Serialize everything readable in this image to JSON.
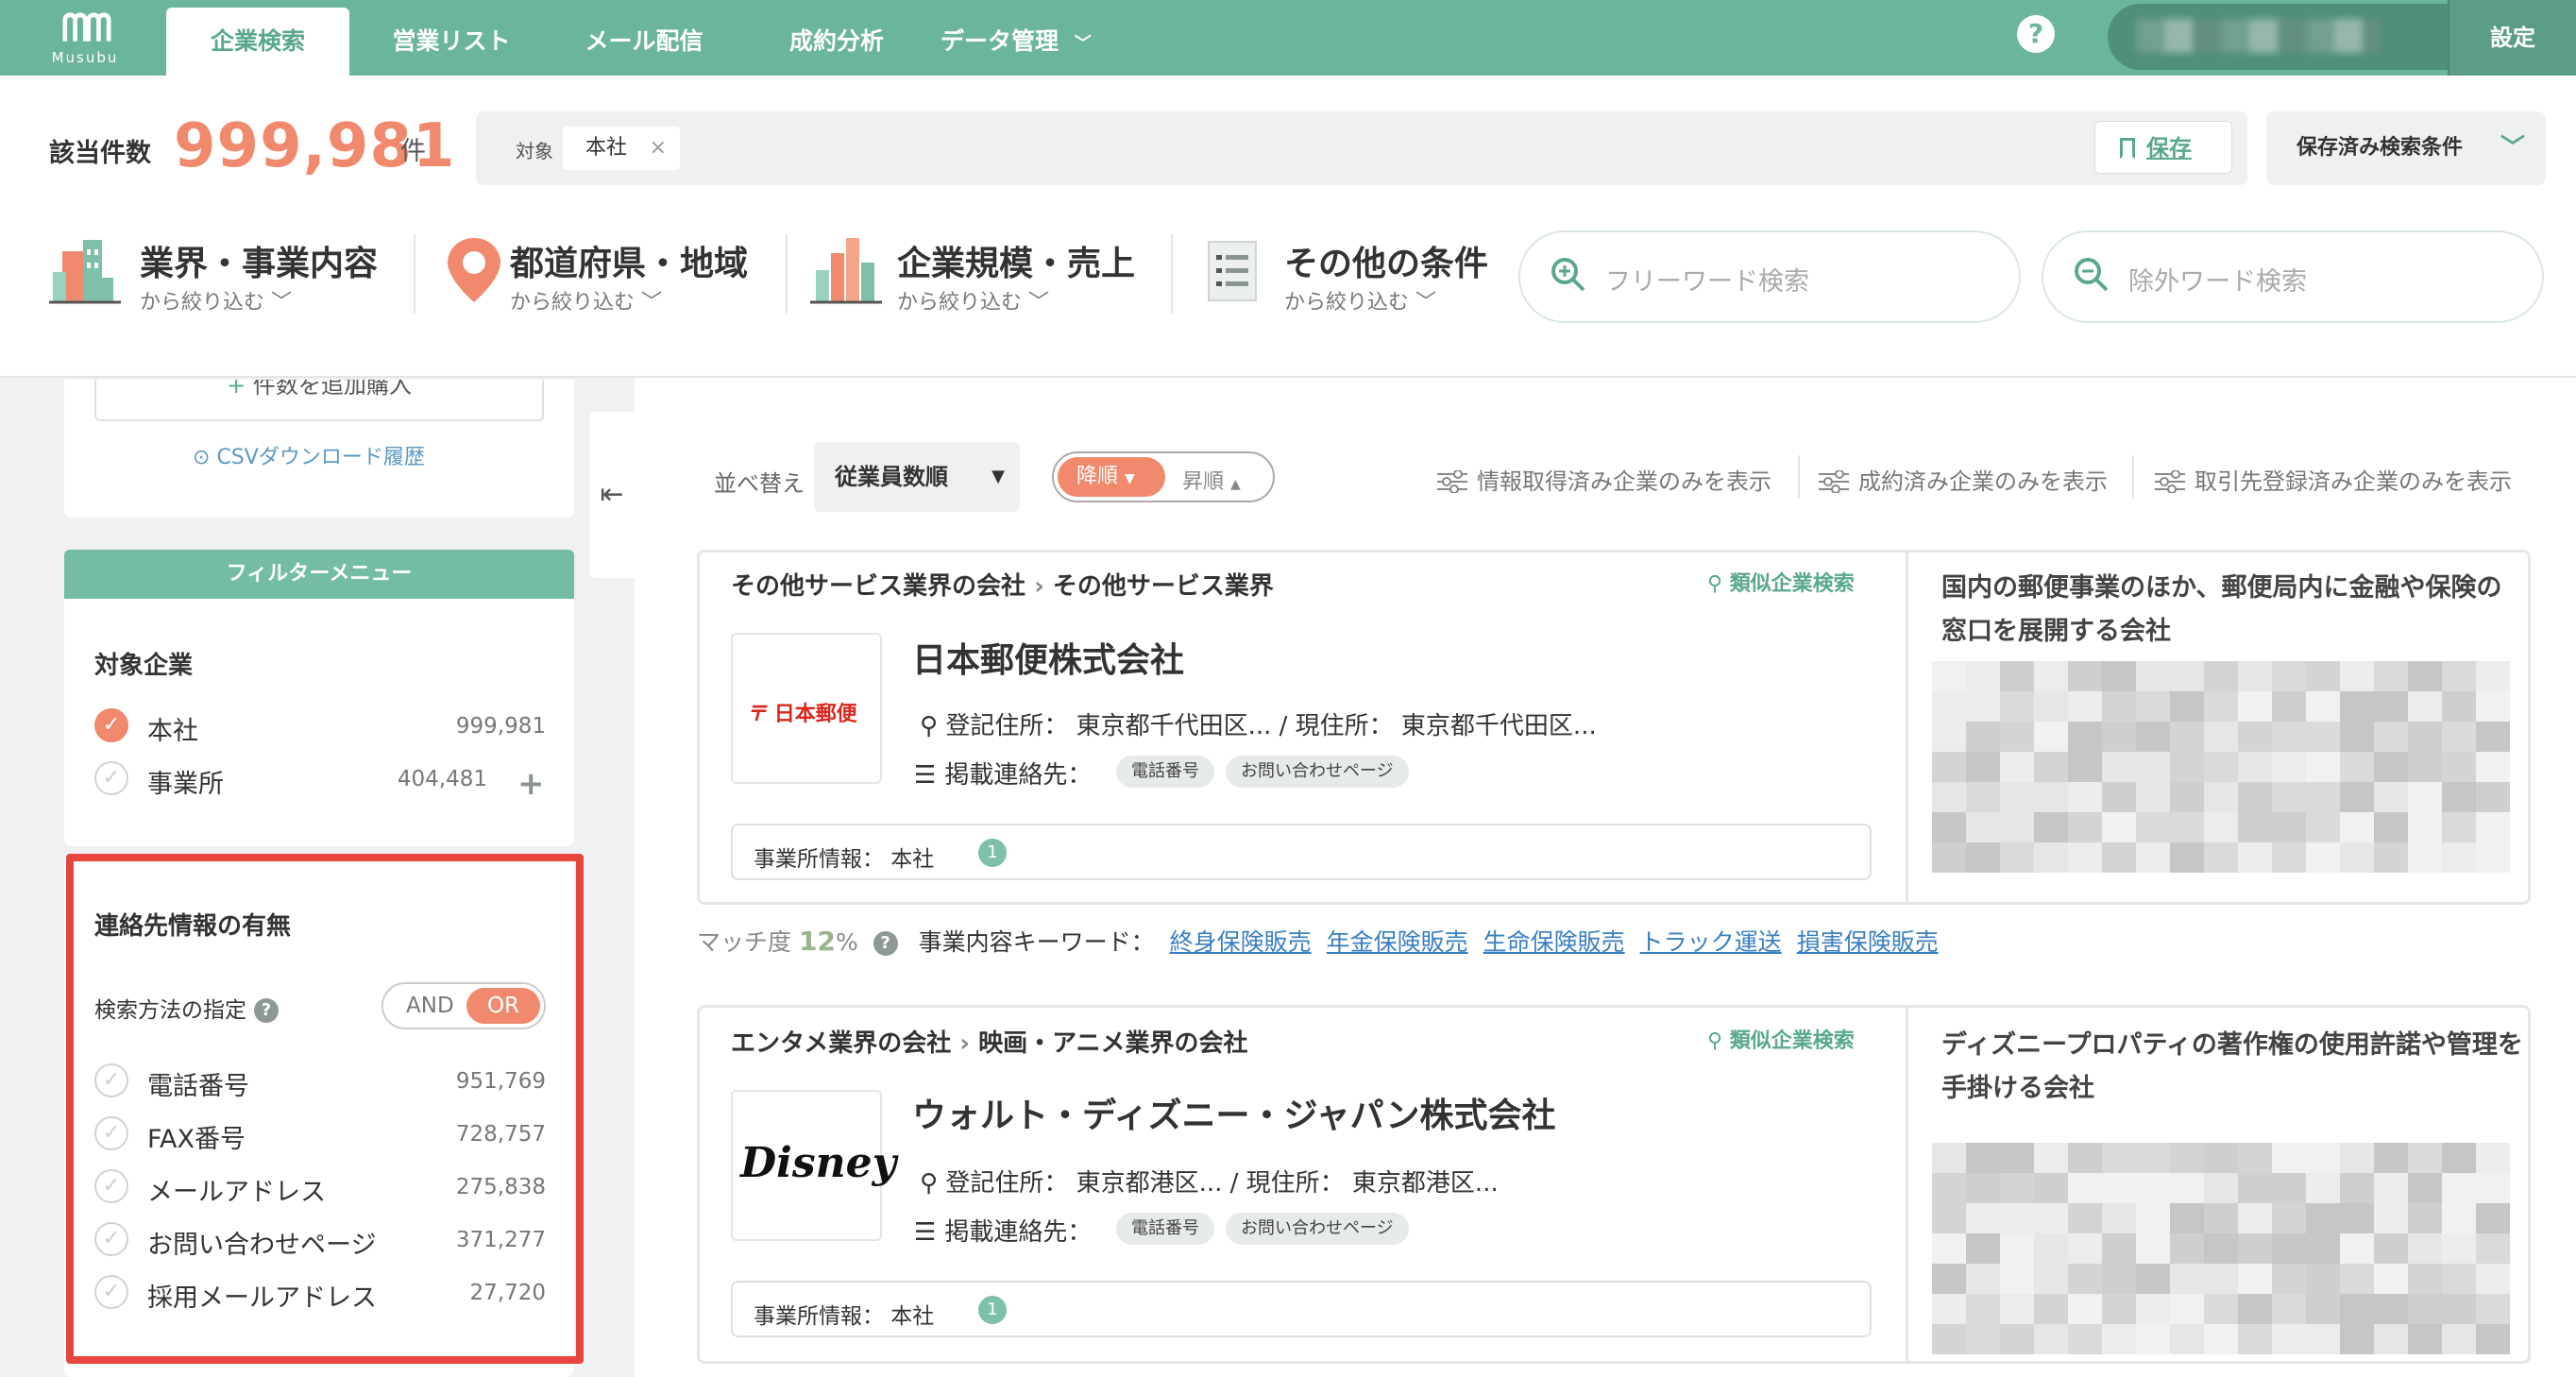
{
  "nav": {
    "logo_text": "Musubu",
    "tabs": [
      {
        "label": "企業検索",
        "active": true
      },
      {
        "label": "営業リスト"
      },
      {
        "label": "メール配信"
      },
      {
        "label": "成約分析"
      },
      {
        "label": "データ管理"
      }
    ],
    "settings_label": "設定",
    "accent_color": "#6bb59b"
  },
  "header": {
    "count_label": "該当件数",
    "count_value": "999,981",
    "count_unit": "件",
    "filter_label": "対象",
    "filter_chip": "本社",
    "filter_chip_remove": "×",
    "save_label": "保存",
    "saved_conditions_label": "保存済み検索条件",
    "categories": [
      {
        "title": "業界・事業内容",
        "sub": "から絞り込む"
      },
      {
        "title": "都道府県・地域",
        "sub": "から絞り込む"
      },
      {
        "title": "企業規模・売上",
        "sub": "から絞り込む"
      },
      {
        "title": "その他の条件",
        "sub": "から絞り込む"
      }
    ],
    "free_word_placeholder": "フリーワード検索",
    "exclude_word_placeholder": "除外ワード検索"
  },
  "sidebar": {
    "add_purchase_label": "件数を追加購入",
    "csv_history_label": "CSVダウンロード履歴",
    "filter_menu_title": "フィルターメニュー",
    "target_section": {
      "title": "対象企業",
      "options": [
        {
          "label": "本社",
          "count": "999,981",
          "checked": true
        },
        {
          "label": "事業所",
          "count": "404,481",
          "checked": false
        }
      ]
    },
    "contact_section": {
      "title": "連絡先情報の有無",
      "method_label": "検索方法の指定",
      "toggle": {
        "and": "AND",
        "or": "OR",
        "selected": "OR"
      },
      "options": [
        {
          "label": "電話番号",
          "count": "951,769"
        },
        {
          "label": "FAX番号",
          "count": "728,757"
        },
        {
          "label": "メールアドレス",
          "count": "275,838"
        },
        {
          "label": "お問い合わせページ",
          "count": "371,277"
        },
        {
          "label": "採用メールアドレス",
          "count": "27,720"
        }
      ]
    }
  },
  "toolbar": {
    "sort_label": "並べ替え",
    "sort_value": "従業員数順",
    "order_desc": "降順",
    "order_asc": "昇順",
    "filters": [
      "情報取得済み企業のみを表示",
      "成約済み企業のみを表示",
      "取引先登録済み企業のみを表示"
    ]
  },
  "results": [
    {
      "breadcrumb_parent": "その他サービス業界の会社",
      "breadcrumb_child": "その他サービス業界",
      "similar_search_label": "類似企業検索",
      "logo_text": "日本郵便",
      "name": "日本郵便株式会社",
      "address": "登記住所： 東京都千代田区... / 現住所： 東京都千代田区...",
      "contact_label": "掲載連絡先：",
      "contact_tags": [
        "電話番号",
        "お問い合わせページ"
      ],
      "office_label": "事業所情報： 本社",
      "office_count": "1",
      "description": "国内の郵便事業のほか、郵便局内に金融や保険の窓口を展開する会社",
      "match_label": "マッチ度",
      "match_value": "12",
      "match_unit": "%",
      "keywords_label": "事業内容キーワード：",
      "keywords": [
        "終身保険販売",
        "年金保険販売",
        "生命保険販売",
        "トラック運送",
        "損害保険販売"
      ]
    },
    {
      "breadcrumb_parent": "エンタメ業界の会社",
      "breadcrumb_child": "映画・アニメ業界の会社",
      "similar_search_label": "類似企業検索",
      "logo_text": "Disney",
      "name": "ウォルト・ディズニー・ジャパン株式会社",
      "address": "登記住所： 東京都港区... / 現住所： 東京都港区...",
      "contact_label": "掲載連絡先：",
      "contact_tags": [
        "電話番号",
        "お問い合わせページ"
      ],
      "office_label": "事業所情報： 本社",
      "office_count": "1",
      "description": "ディズニープロパティの著作権の使用許諾や管理を手掛ける会社"
    }
  ]
}
